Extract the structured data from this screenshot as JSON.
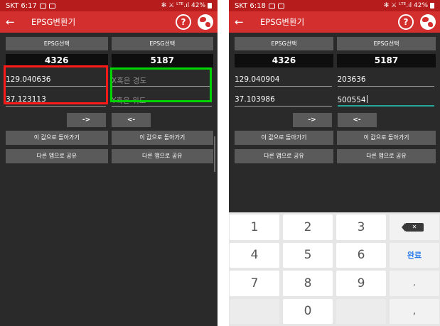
{
  "app": {
    "title": "EPSG변환기",
    "back_icon": "back-arrow-icon",
    "help_label": "?",
    "colors": {
      "appbar": "#d32f2f",
      "statusbar": "#b71c1c",
      "background": "#2a2a2a",
      "button": "#5a5a5a",
      "accent_field": "#26a69a",
      "highlight_red": "#ff1a1a",
      "highlight_green": "#00d400"
    }
  },
  "screens": [
    {
      "status": {
        "time": "SKT 6:17",
        "right": "✻ ⚔ ᴸᵀᴱ.ıl 42%"
      },
      "select_left": "EPSG선택",
      "select_right": "EPSG선택",
      "code_left": "4326",
      "code_right": "5187",
      "left_x": "129.040636",
      "left_y": "37.123113",
      "right_x_placeholder": "X혹은 경도",
      "right_y_placeholder": "Y혹은 위도",
      "arrow_right": "->",
      "arrow_left": "<-",
      "return_left": "이 값으로 돌아가기",
      "return_right": "이 값으로 돌아가기",
      "share_left": "다른 앱으로 공유",
      "share_right": "다른 앱으로 공유"
    },
    {
      "status": {
        "time": "SKT 6:18",
        "right": "✻ ⚔ ᴸᵀᴱ.ıl 42%"
      },
      "select_left": "EPSG선택",
      "select_right": "EPSG선택",
      "code_left": "4326",
      "code_right": "5187",
      "left_x": "129.040904",
      "left_y": "37.103986",
      "right_x": "203636",
      "right_y": "500554",
      "arrow_right": "->",
      "arrow_left": "<-",
      "return_left": "이 값으로 돌아가기",
      "return_right": "이 값으로 돌아가기",
      "share_left": "다른 앱으로 공유",
      "share_right": "다른 앱으로 공유"
    }
  ],
  "keyboard": {
    "keys": [
      "1",
      "2",
      "3",
      "4",
      "5",
      "6",
      "7",
      "8",
      "9",
      "0"
    ],
    "done": "완료",
    "dot": ".",
    "comma": ",",
    "delete_icon": "backspace-icon"
  }
}
